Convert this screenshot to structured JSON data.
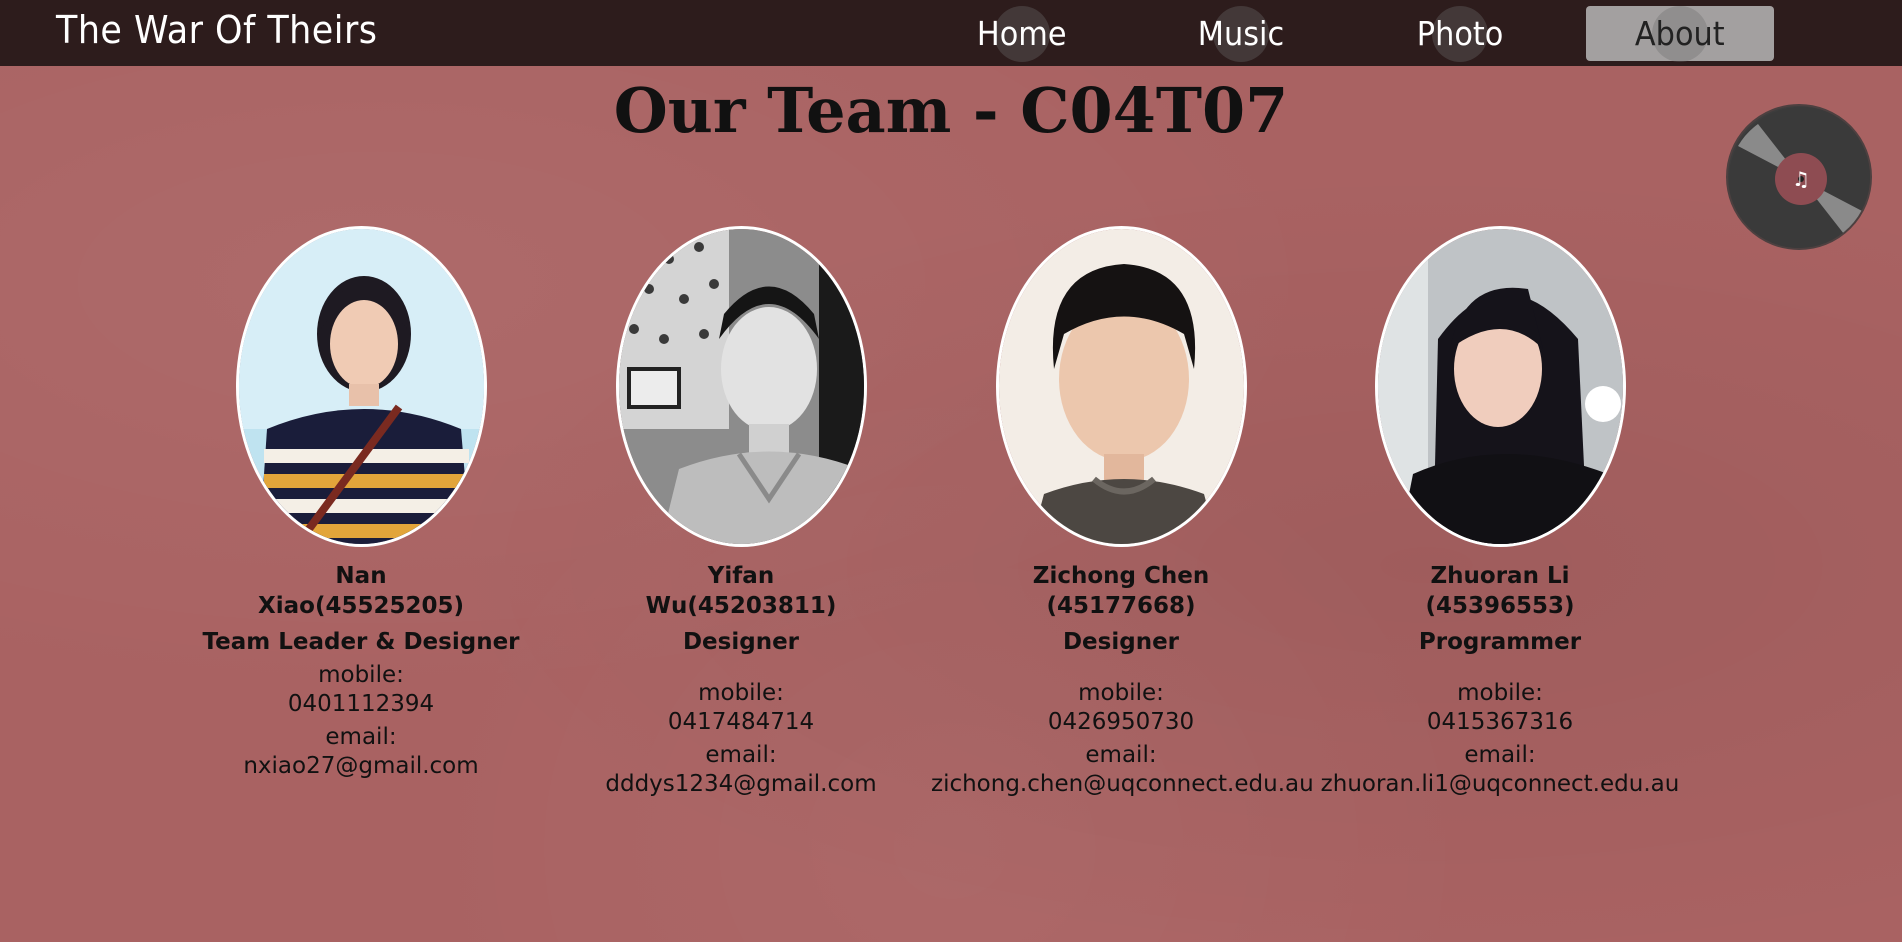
{
  "header": {
    "brand": "The War Of Theirs",
    "nav": [
      {
        "label": "Home",
        "active": false
      },
      {
        "label": "Music",
        "active": false
      },
      {
        "label": "Photo",
        "active": false
      },
      {
        "label": "About",
        "active": true
      }
    ]
  },
  "page": {
    "title": "Our Team - C04T07"
  },
  "colors": {
    "background": "#a96262",
    "topbar": "#2d1c1c",
    "active_nav": "#a3a0a0"
  },
  "music_player": {
    "icon": "vinyl-record-icon"
  },
  "team": [
    {
      "name": "Nan Xiao(45525205)",
      "role": "Team Leader & Designer",
      "mobile_label": "mobile:",
      "mobile": "0401112394",
      "email_label": "email:",
      "email": "nxiao27@gmail.com"
    },
    {
      "name": "Yifan Wu(45203811)",
      "role": "Designer",
      "mobile_label": "mobile:",
      "mobile": "0417484714",
      "email_label": "email:",
      "email": "dddys1234@gmail.com"
    },
    {
      "name": "Zichong Chen (45177668)",
      "role": "Designer",
      "mobile_label": "mobile:",
      "mobile": "0426950730",
      "email_label": "email:",
      "email": "zichong.chen@uqconnect.edu.au"
    },
    {
      "name": "Zhuoran Li (45396553)",
      "role": "Programmer",
      "mobile_label": "mobile:",
      "mobile": "0415367316",
      "email_label": "email:",
      "email": "zhuoran.li1@uqconnect.edu.au"
    }
  ]
}
